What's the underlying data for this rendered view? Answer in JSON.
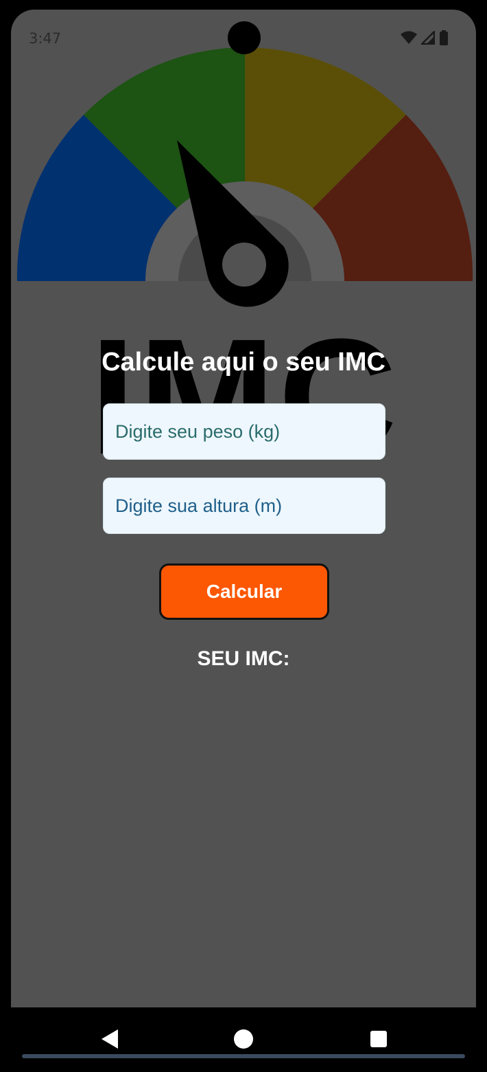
{
  "status_bar": {
    "time": "3:47",
    "icons": [
      "wifi-icon",
      "signal-icon",
      "battery-icon"
    ]
  },
  "background": {
    "logo_text": "IMC",
    "gauge_colors": [
      "#023170",
      "#1d5313",
      "#5b4f08",
      "#541e10"
    ]
  },
  "main": {
    "title": "Calcule aqui o seu IMC",
    "weight_placeholder": "Digite seu peso (kg)",
    "height_placeholder": "Digite sua altura (m)",
    "calculate_label": "Calcular",
    "result_label": "SEU IMC:"
  },
  "nav_bar": {
    "buttons": [
      "back-icon",
      "home-icon",
      "recents-icon"
    ]
  },
  "colors": {
    "screen_background": "#525252",
    "button": "#fc5703",
    "field_background": "#eef7fd"
  }
}
